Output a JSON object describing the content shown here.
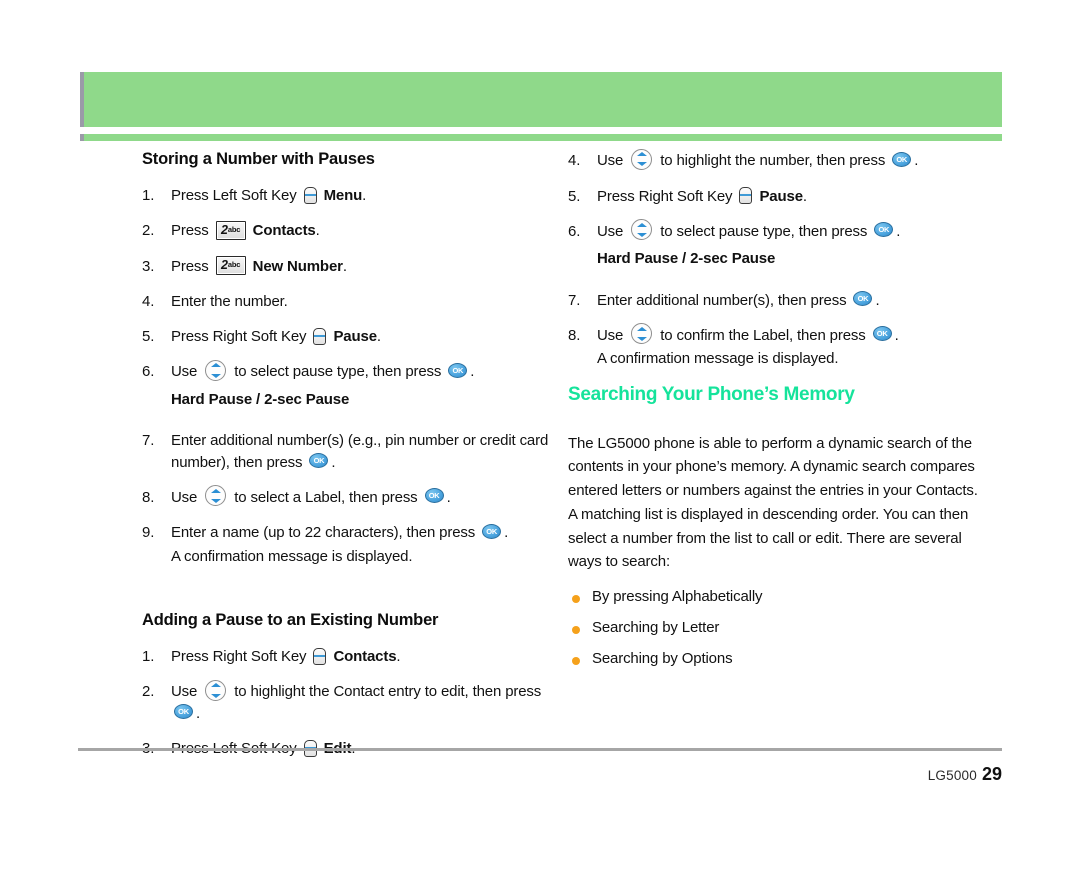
{
  "document": {
    "title": "Storing a Number with Pauses",
    "page_number": "29",
    "brand": "LG5000"
  },
  "header": {
    "band_color": "#8FD98A",
    "rule_color": "#8FD98A",
    "tab_color": "#9a9aa8"
  },
  "icons": {
    "soft_key": "soft-key-icon",
    "key_2": {
      "digit": "2",
      "letters": "abc"
    },
    "nav_wheel": "navigation-up-down-icon",
    "ok_key": "OK"
  },
  "left_column": {
    "section_1": {
      "heading": "Storing a Number with Pauses",
      "steps": [
        {
          "num": "1.",
          "parts": [
            {
              "t": "text",
              "v": "Press Left Soft Key "
            },
            {
              "t": "icon",
              "v": "soft"
            },
            {
              "t": "bold",
              "v": " Menu"
            },
            {
              "t": "text",
              "v": "."
            }
          ]
        },
        {
          "num": "2.",
          "parts": [
            {
              "t": "text",
              "v": "Press "
            },
            {
              "t": "icon",
              "v": "key2"
            },
            {
              "t": "bold",
              "v": " Contacts"
            },
            {
              "t": "text",
              "v": "."
            }
          ]
        },
        {
          "num": "3.",
          "parts": [
            {
              "t": "text",
              "v": "Press "
            },
            {
              "t": "icon",
              "v": "key2"
            },
            {
              "t": "bold",
              "v": " New Number"
            },
            {
              "t": "text",
              "v": "."
            }
          ]
        },
        {
          "num": "4.",
          "parts": [
            {
              "t": "text",
              "v": "Enter the number."
            }
          ]
        },
        {
          "num": "5.",
          "parts": [
            {
              "t": "text",
              "v": "Press Right Soft Key "
            },
            {
              "t": "icon",
              "v": "soft"
            },
            {
              "t": "bold",
              "v": " Pause"
            },
            {
              "t": "text",
              "v": "."
            }
          ]
        },
        {
          "num": "6.",
          "parts": [
            {
              "t": "text",
              "v": "Use "
            },
            {
              "t": "icon",
              "v": "nav"
            },
            {
              "t": "text",
              "v": " to select pause type, then press "
            },
            {
              "t": "icon",
              "v": "ok"
            },
            {
              "t": "text",
              "v": "."
            }
          ]
        }
      ],
      "pause_types": "Hard Pause / 2-sec Pause",
      "steps_cont": [
        {
          "num": "7.",
          "parts": [
            {
              "t": "text",
              "v": "Enter additional number(s) (e.g., pin number or credit card number), then press "
            },
            {
              "t": "icon",
              "v": "ok"
            },
            {
              "t": "text",
              "v": "."
            }
          ]
        },
        {
          "num": "8.",
          "parts": [
            {
              "t": "text",
              "v": "Use "
            },
            {
              "t": "icon",
              "v": "nav"
            },
            {
              "t": "text",
              "v": " to select a Label, then press "
            },
            {
              "t": "icon",
              "v": "ok"
            },
            {
              "t": "text",
              "v": "."
            }
          ]
        },
        {
          "num": "9.",
          "parts": [
            {
              "t": "text",
              "v": "Enter a name (up to 22 characters), then press "
            },
            {
              "t": "icon",
              "v": "ok"
            },
            {
              "t": "text",
              "v": "."
            },
            {
              "t": "note",
              "v": "A confirmation message is displayed."
            }
          ]
        }
      ]
    },
    "section_2": {
      "heading": "Adding a Pause to an Existing Number",
      "steps": [
        {
          "num": "1.",
          "parts": [
            {
              "t": "text",
              "v": "Press Right Soft Key "
            },
            {
              "t": "icon",
              "v": "soft"
            },
            {
              "t": "bold",
              "v": " Contacts"
            },
            {
              "t": "text",
              "v": "."
            }
          ]
        },
        {
          "num": "2.",
          "parts": [
            {
              "t": "text",
              "v": "Use "
            },
            {
              "t": "icon",
              "v": "nav"
            },
            {
              "t": "text",
              "v": " to highlight the Contact entry to edit, then press "
            },
            {
              "t": "icon",
              "v": "ok"
            },
            {
              "t": "text",
              "v": "."
            }
          ]
        },
        {
          "num": "3.",
          "parts": [
            {
              "t": "text",
              "v": "Press Left Soft Key "
            },
            {
              "t": "icon",
              "v": "soft"
            },
            {
              "t": "bold",
              "v": " Edit"
            },
            {
              "t": "text",
              "v": "."
            }
          ]
        }
      ]
    }
  },
  "right_column": {
    "steps_cont": [
      {
        "num": "4.",
        "parts": [
          {
            "t": "text",
            "v": "Use "
          },
          {
            "t": "icon",
            "v": "nav"
          },
          {
            "t": "text",
            "v": " to highlight the number, then press "
          },
          {
            "t": "icon",
            "v": "ok"
          },
          {
            "t": "text",
            "v": "."
          }
        ]
      },
      {
        "num": "5.",
        "parts": [
          {
            "t": "text",
            "v": "Press Right Soft Key "
          },
          {
            "t": "icon",
            "v": "soft"
          },
          {
            "t": "bold",
            "v": " Pause"
          },
          {
            "t": "text",
            "v": "."
          }
        ]
      },
      {
        "num": "6.",
        "parts": [
          {
            "t": "text",
            "v": "Use "
          },
          {
            "t": "icon",
            "v": "nav"
          },
          {
            "t": "text",
            "v": " to select pause type, then press "
          },
          {
            "t": "icon",
            "v": "ok"
          },
          {
            "t": "text",
            "v": "."
          }
        ]
      }
    ],
    "pause_types": "Hard Pause / 2-sec Pause",
    "steps_cont2": [
      {
        "num": "7.",
        "parts": [
          {
            "t": "text",
            "v": "Enter additional number(s), then press "
          },
          {
            "t": "icon",
            "v": "ok"
          },
          {
            "t": "text",
            "v": "."
          }
        ]
      },
      {
        "num": "8.",
        "parts": [
          {
            "t": "text",
            "v": "Use "
          },
          {
            "t": "icon",
            "v": "nav"
          },
          {
            "t": "text",
            "v": " to confirm the Label, then press "
          },
          {
            "t": "icon",
            "v": "ok"
          },
          {
            "t": "text",
            "v": "."
          },
          {
            "t": "note",
            "v": "A confirmation message is displayed."
          }
        ]
      }
    ],
    "memory_section": {
      "heading": "Searching Your Phone’s Memory",
      "heading_color": "#15E39B",
      "paragraph": "The LG5000 phone is able to perform a dynamic search of the contents in your phone’s memory. A dynamic search compares entered letters or numbers against the entries in your Contacts. A matching list is displayed in descending order. You can then select a number from the list to call or edit. There are several ways to search:",
      "bullet_color": "#F5A11B",
      "bullets": [
        "By pressing Alphabetically",
        "Searching by Letter",
        "Searching by Options"
      ]
    }
  }
}
